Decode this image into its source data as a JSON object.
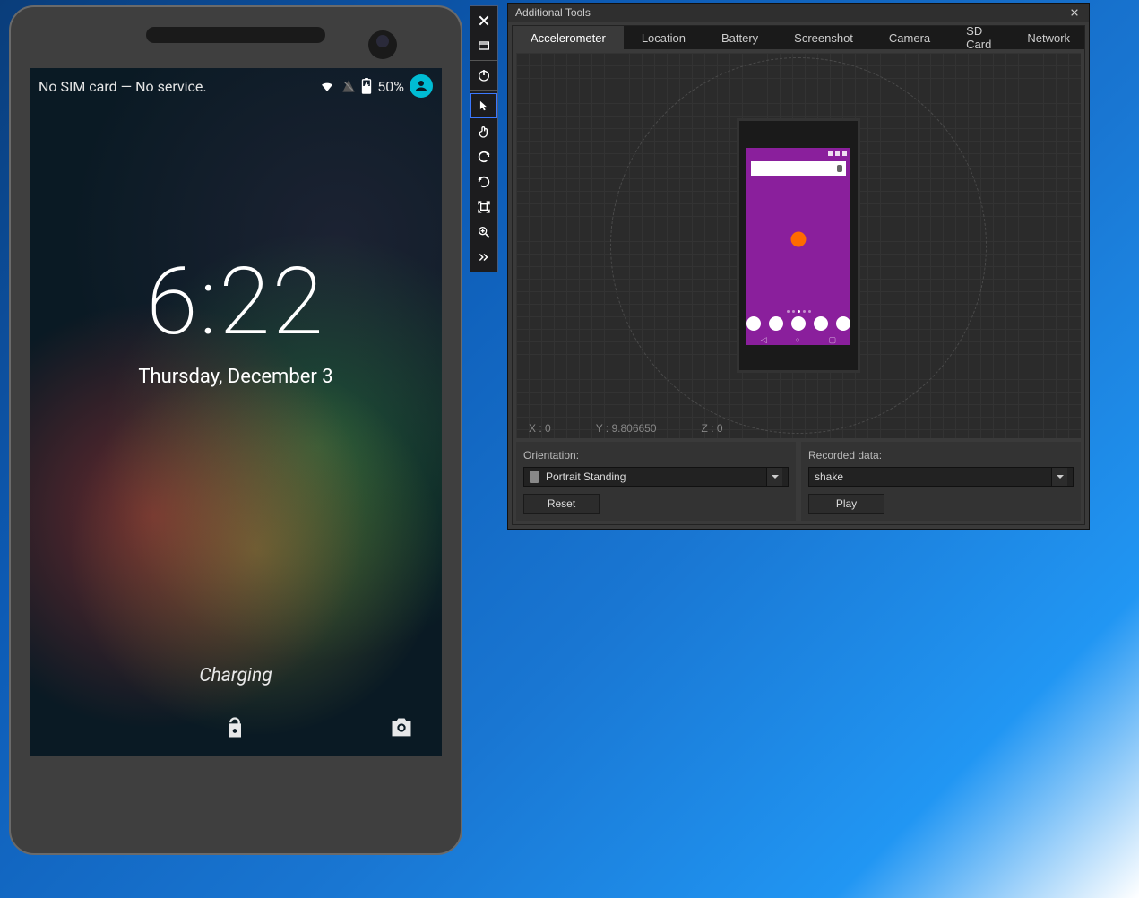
{
  "emulator": {
    "status_text": "No SIM card — No service.",
    "battery_pct": "50%",
    "clock": "6:22",
    "date": "Thursday, December 3",
    "charging_label": "Charging"
  },
  "toolbar": {
    "items": [
      {
        "name": "close-icon"
      },
      {
        "name": "minimize-icon"
      },
      {
        "name": "power-icon"
      },
      {
        "name": "pointer-icon"
      },
      {
        "name": "touch-icon"
      },
      {
        "name": "rotate-left-icon"
      },
      {
        "name": "rotate-right-icon"
      },
      {
        "name": "fit-screen-icon"
      },
      {
        "name": "zoom-icon"
      },
      {
        "name": "more-icon"
      }
    ]
  },
  "tools": {
    "title": "Additional Tools",
    "tabs": [
      "Accelerometer",
      "Location",
      "Battery",
      "Screenshot",
      "Camera",
      "SD Card",
      "Network"
    ],
    "active_tab": "Accelerometer",
    "xyz": {
      "x": "X : 0",
      "y": "Y : 9.806650",
      "z": "Z : 0"
    },
    "orientation": {
      "label": "Orientation:",
      "selected": "Portrait Standing",
      "button": "Reset"
    },
    "recorded": {
      "label": "Recorded data:",
      "selected": "shake",
      "button": "Play"
    }
  }
}
